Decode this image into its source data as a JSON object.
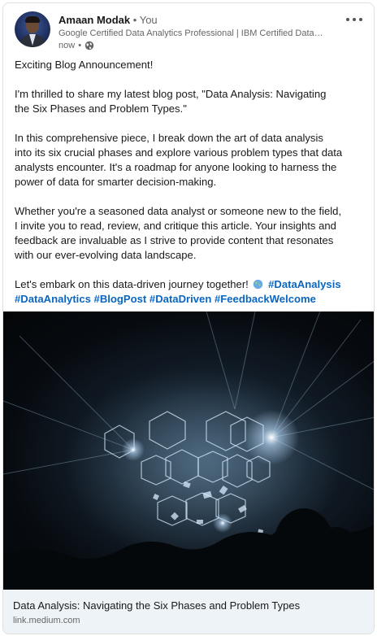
{
  "author": {
    "name": "Amaan Modak",
    "separator": "•",
    "relation": "You",
    "headline": "Google Certified Data Analytics Professional | IBM Certified Data W...",
    "time": "now",
    "time_separator": "•",
    "visibility_icon": "globe-icon"
  },
  "menu": {
    "icon": "more-options-icon"
  },
  "post": {
    "p1": "Exciting Blog Announcement!",
    "p2": "I'm thrilled to share my latest blog post, \"Data Analysis: Navigating the Six Phases and Problem Types.\"",
    "p3": "In this comprehensive piece, I break down the art of data analysis into its six crucial phases and explore various problem types that data analysts encounter. It's a roadmap for anyone looking to harness the power of data for smarter decision-making.",
    "p4": "Whether you're a seasoned data analyst or someone new to the field, I invite you to read, review, and critique this article. Your insights and feedback are invaluable as I strive to provide content that resonates with our ever-evolving data landscape.",
    "p5_text": "Let's embark on this data-driven journey together!",
    "p5_emoji_icon": "globe-emoji-icon",
    "hashtags": [
      "#DataAnalysis",
      "#DataAnalytics",
      "#BlogPost",
      "#DataDriven",
      "#FeedbackWelcome"
    ]
  },
  "link_preview": {
    "title": "Data Analysis: Navigating the Six Phases and Problem Types",
    "domain": "link.medium.com"
  },
  "colors": {
    "link": "#0a66c2",
    "text": "#191919",
    "muted": "#666666",
    "preview_bg": "#eef3f8"
  }
}
